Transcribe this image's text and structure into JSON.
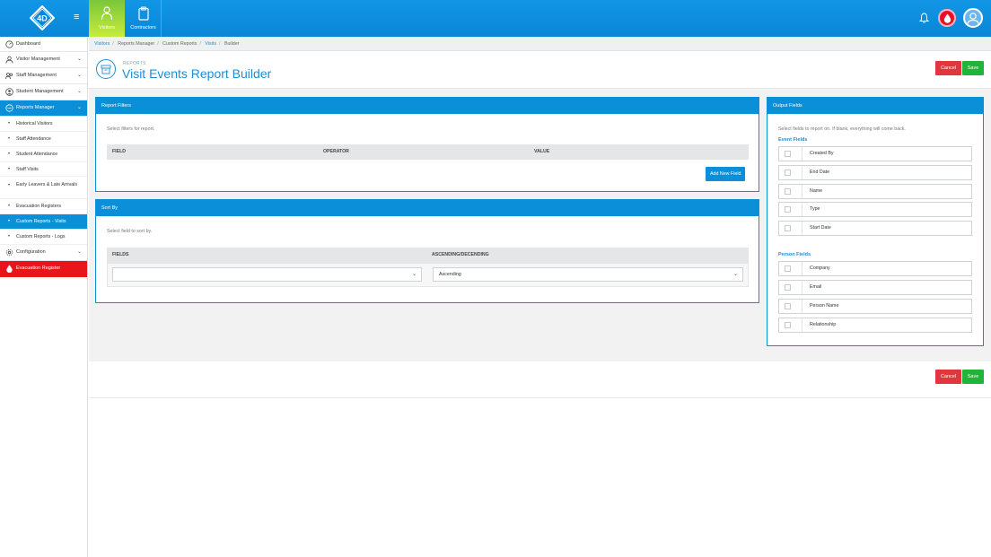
{
  "topbar": {
    "logo_text": "4D",
    "tabs": [
      {
        "label": "Visitors"
      },
      {
        "label": "Contractors"
      }
    ]
  },
  "sidebar": {
    "items": [
      {
        "label": "Dashboard"
      },
      {
        "label": "Visitor Management"
      },
      {
        "label": "Staff Management"
      },
      {
        "label": "Student Management"
      },
      {
        "label": "Reports Manager"
      }
    ],
    "sub_items": [
      {
        "label": "Historical Visitors"
      },
      {
        "label": "Staff Attendance"
      },
      {
        "label": "Student Attendance"
      },
      {
        "label": "Staff Visits"
      },
      {
        "label": "Early Leavers & Late Arrivals"
      },
      {
        "label": "Evacuation Registers"
      },
      {
        "label": "Custom Reports - Visits"
      },
      {
        "label": "Custom Reports - Logs"
      }
    ],
    "configuration": "Configuration",
    "evacuation_register": "Evacuation Register"
  },
  "breadcrumb": [
    "Visitors",
    "Reports Manager",
    "Custom Reports",
    "Visits",
    "Builder"
  ],
  "header": {
    "subtitle": "REPORTS",
    "title": "Visit Events Report Builder",
    "cancel": "Cancel",
    "save": "Save"
  },
  "report_filters": {
    "title": "Report Filters",
    "hint": "Select filters for report.",
    "columns": [
      "FIELD",
      "OPERATOR",
      "VALUE"
    ],
    "add_button": "Add New Field"
  },
  "sort_by": {
    "title": "Sort By",
    "hint": "Select field to sort by.",
    "columns": [
      "FIELDS",
      "ASCENDING/DECENDING"
    ],
    "field_value": "",
    "order_value": "Ascending"
  },
  "output_fields": {
    "title": "Output Fields",
    "hint": "Select fields to report on. If blank, everything will come back.",
    "event_fields_title": "Event Fields",
    "event_fields": [
      "Created By",
      "End Date",
      "Name",
      "Type",
      "Start Date"
    ],
    "person_fields_title": "Person Fields",
    "person_fields": [
      "Company",
      "Email",
      "Person Name",
      "Relationship"
    ]
  },
  "footer": {
    "cancel": "Cancel",
    "save": "Save"
  },
  "colors": {
    "primary": "#0b8fd9",
    "cancel": "#e0363c",
    "save": "#21b43a",
    "evacuation": "#e8151b",
    "visitors_tab": "#9ed43c"
  }
}
